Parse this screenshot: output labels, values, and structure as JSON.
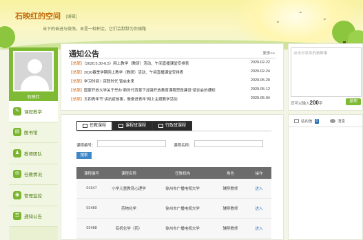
{
  "header": {
    "site_title": "石映红的空间",
    "edit_label": "[编辑]",
    "motto": "当下的奋进与微荡，显是一种积淀，它们会默默为你铺路"
  },
  "sidebar": {
    "username": "石映红",
    "items": [
      {
        "label": "课程教学",
        "icon": "book-icon"
      },
      {
        "label": "图书馆",
        "icon": "library-icon"
      },
      {
        "label": "教师团队",
        "icon": "team-icon"
      },
      {
        "label": "任教情况",
        "icon": "chat-icon"
      },
      {
        "label": "管理监控",
        "icon": "eye-icon"
      },
      {
        "label": "通知公告",
        "icon": "notice-icon"
      }
    ]
  },
  "notice": {
    "title": "通知公告",
    "more": "更多>>",
    "items": [
      {
        "tag": "【总部】",
        "text": "（2020.5.30-6.5）网上教学（教研）活动、午间直播课堂安排表",
        "date": "2020-02-22"
      },
      {
        "tag": "【总部】",
        "text": "2020春季学期网上教学（教研）活动、午间直播课堂安排表",
        "date": "2020-02-24"
      },
      {
        "tag": "【总部】",
        "text": "学习时间丨百联时代 智启未来",
        "date": "2020-05-20"
      },
      {
        "tag": "【总部】",
        "text": "国家开放大学关于举办“新时代背景下加强开放教育课程思政建设”培训会的通知",
        "date": "2020-05-12"
      },
      {
        "tag": "【总部】",
        "text": "五四青年节“讲抗疫故事，做奋进青年”网上主题教学活动",
        "date": "2020-05-04"
      }
    ]
  },
  "status": {
    "placeholder": "点击分享你的新鲜事",
    "count_prefix": "还可以输入",
    "count_value": "200",
    "count_suffix": "字",
    "publish": "发布"
  },
  "messages": {
    "inbox": "站内信",
    "inbox_count": "0",
    "news": "消息"
  },
  "courses": {
    "tabs": [
      "任教课程",
      "课程班课程",
      "行政班课程"
    ],
    "course_no_label": "课程编号：",
    "course_name_label": "课程名称：",
    "search": "搜索",
    "headers": [
      "课程编号",
      "课程名称",
      "任教机构",
      "角色",
      "操作"
    ],
    "rows": [
      [
        "01647",
        "小学儿童教育心理学",
        "徐州市广播电视大学",
        "辅导教师",
        "进入"
      ],
      [
        "02480",
        "药物化学",
        "徐州市广播电视大学",
        "辅导教师",
        "进入"
      ],
      [
        "02488",
        "有机化学（药）",
        "徐州市广播电视大学",
        "辅导教师",
        "进入"
      ]
    ]
  },
  "colors": {
    "accent": "#7fba35",
    "link": "#2c6fb8",
    "title": "#c36a09"
  }
}
